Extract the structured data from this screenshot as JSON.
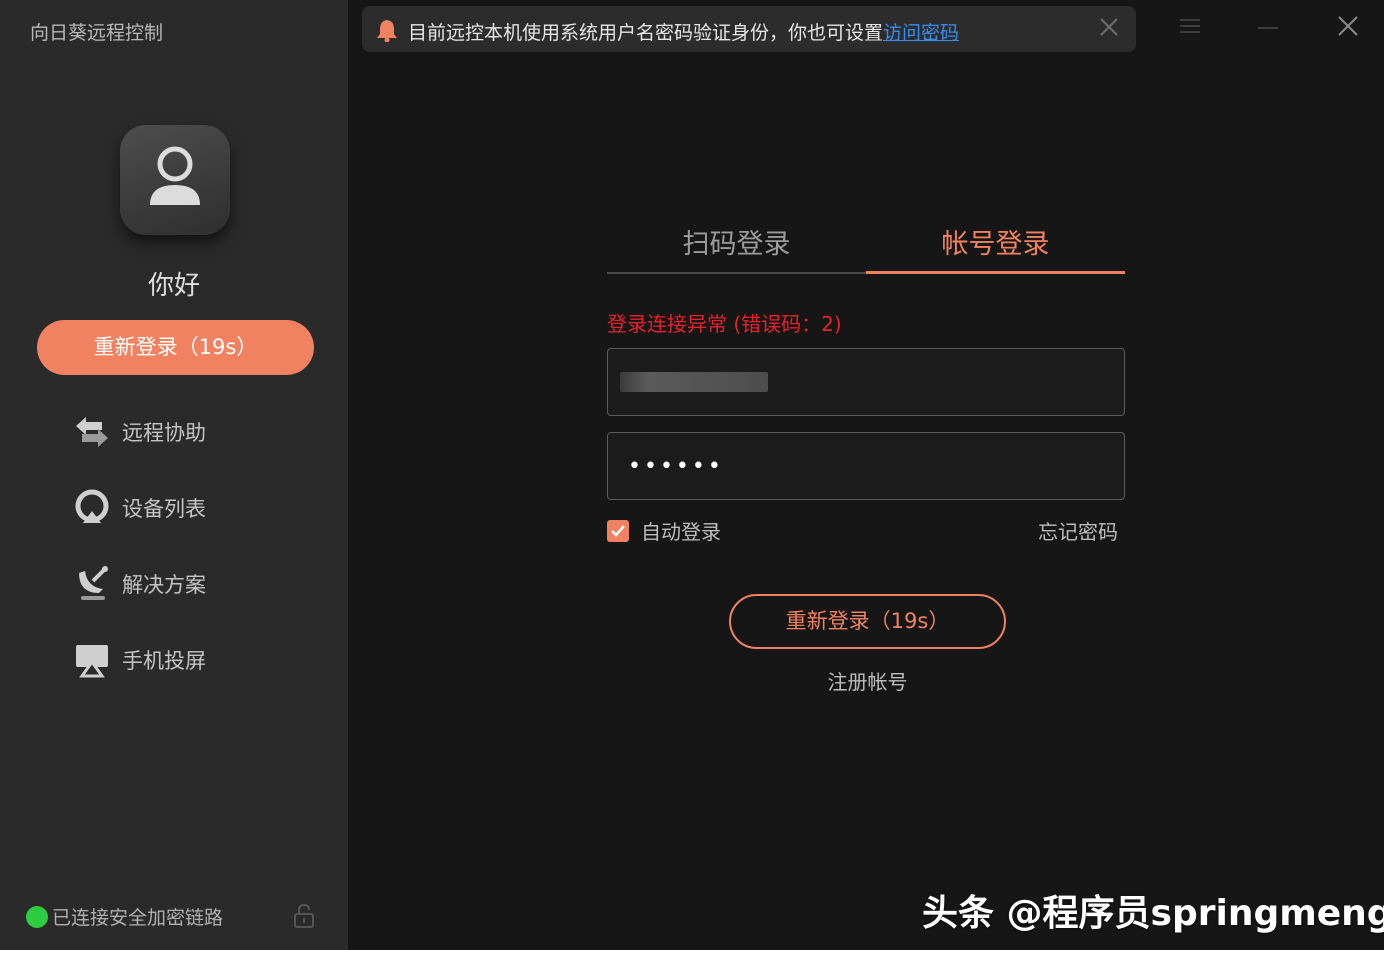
{
  "app": {
    "title": "向日葵远程控制"
  },
  "sidebar": {
    "greeting": "你好",
    "relogin_label": "重新登录（19s）",
    "items": [
      {
        "label": "远程协助",
        "icon": "remote-assist-icon"
      },
      {
        "label": "设备列表",
        "icon": "device-list-icon"
      },
      {
        "label": "解决方案",
        "icon": "solutions-icon"
      },
      {
        "label": "手机投屏",
        "icon": "screen-cast-icon"
      }
    ],
    "status_text": "已连接安全加密链路",
    "status_color": "#2ecc40"
  },
  "notification": {
    "text": "目前远控本机使用系统用户名密码验证身份，你也可设置",
    "link": "访问密码"
  },
  "login": {
    "tabs": [
      {
        "label": "扫码登录",
        "active": false
      },
      {
        "label": "帐号登录",
        "active": true
      }
    ],
    "error": "登录连接异常 (错误码：2)",
    "password_value": "••••••",
    "auto_login_label": "自动登录",
    "auto_login_checked": true,
    "forgot_label": "忘记密码",
    "relogin_label": "重新登录（19s）",
    "register_label": "注册帐号"
  },
  "watermark": "头条 @程序员springmeng",
  "colors": {
    "accent": "#f08262",
    "error": "#e8202c",
    "link": "#3a8bf0",
    "sidebar_bg": "#2a2a2a",
    "main_bg": "#161616"
  }
}
